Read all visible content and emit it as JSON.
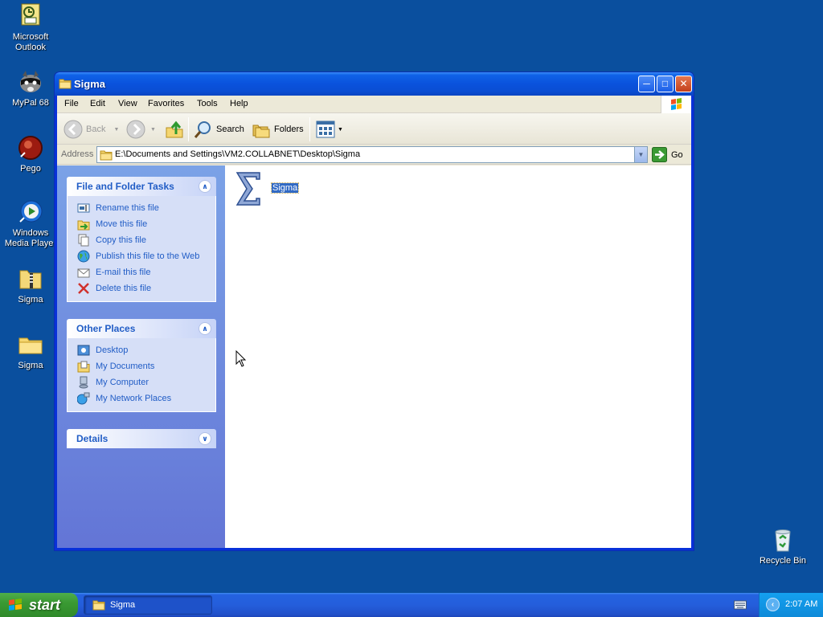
{
  "desktop": {
    "icons": [
      {
        "label": "Microsoft Outlook"
      },
      {
        "label": "MyPal 68"
      },
      {
        "label": "Pego"
      },
      {
        "label": "Windows Media Player"
      },
      {
        "label": "Sigma"
      },
      {
        "label": "Sigma"
      },
      {
        "label": "Recycle Bin"
      }
    ]
  },
  "window": {
    "title": "Sigma",
    "menu": [
      "File",
      "Edit",
      "View",
      "Favorites",
      "Tools",
      "Help"
    ],
    "toolbar": {
      "back": "Back",
      "search": "Search",
      "folders": "Folders"
    },
    "address": {
      "label": "Address",
      "value": "E:\\Documents and Settings\\VM2.COLLABNET\\Desktop\\Sigma",
      "go": "Go"
    },
    "tasks": {
      "file_folder": {
        "title": "File and Folder Tasks",
        "items": [
          "Rename this file",
          "Move this file",
          "Copy this file",
          "Publish this file to the Web",
          "E-mail this file",
          "Delete this file"
        ]
      },
      "other_places": {
        "title": "Other Places",
        "items": [
          "Desktop",
          "My Documents",
          "My Computer",
          "My Network Places"
        ]
      },
      "details": {
        "title": "Details"
      }
    },
    "files": [
      {
        "name": "Sigma",
        "selected": true
      }
    ]
  },
  "taskbar": {
    "start": "start",
    "tasks": [
      "Sigma"
    ],
    "clock": "2:07 AM"
  },
  "colors": {
    "desktop": "#0a4f9e",
    "titlebar": "#0a52dc",
    "taskpane_link": "#215dc6",
    "selection": "#316ac5",
    "start_green": "#3a9a33"
  }
}
